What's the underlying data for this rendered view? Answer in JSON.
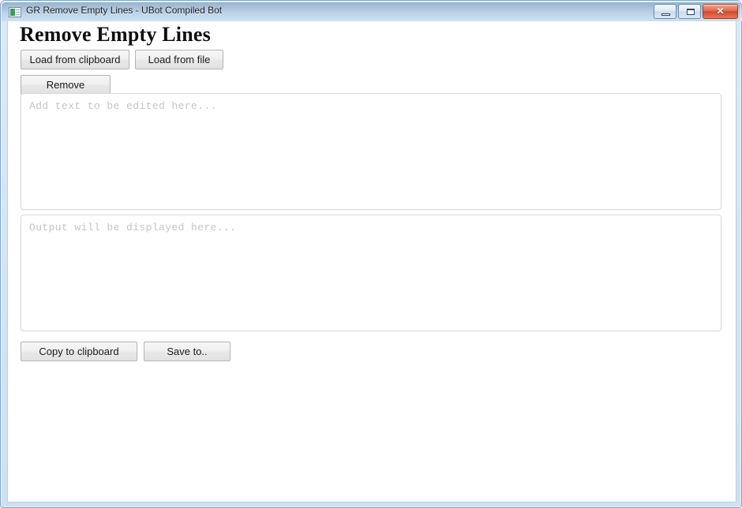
{
  "window": {
    "title": "GR Remove Empty Lines - UBot Compiled Bot",
    "app_icon": "document-window-icon",
    "controls": {
      "minimize": "minimize-icon",
      "maximize": "maximize-icon",
      "close": "✕"
    },
    "colors": {
      "titlebar_top": "#8ca7c2",
      "titlebar_bottom": "#cfe1f2",
      "frame_border": "#7ea6cc",
      "close_button": "#cf4a2c",
      "client_background": "#ffffff"
    }
  },
  "page": {
    "heading": "Remove Empty Lines"
  },
  "toolbar": {
    "load_clipboard_label": "Load from clipboard",
    "load_file_label": "Load from file",
    "remove_label": "Remove"
  },
  "input": {
    "name": "input-textarea",
    "value": "",
    "placeholder": "Add text to be edited here..."
  },
  "output": {
    "name": "output-textarea",
    "value": "",
    "placeholder": "Output will be displayed here..."
  },
  "footer": {
    "copy_clipboard_label": "Copy to clipboard",
    "save_to_label": "Save to.."
  }
}
